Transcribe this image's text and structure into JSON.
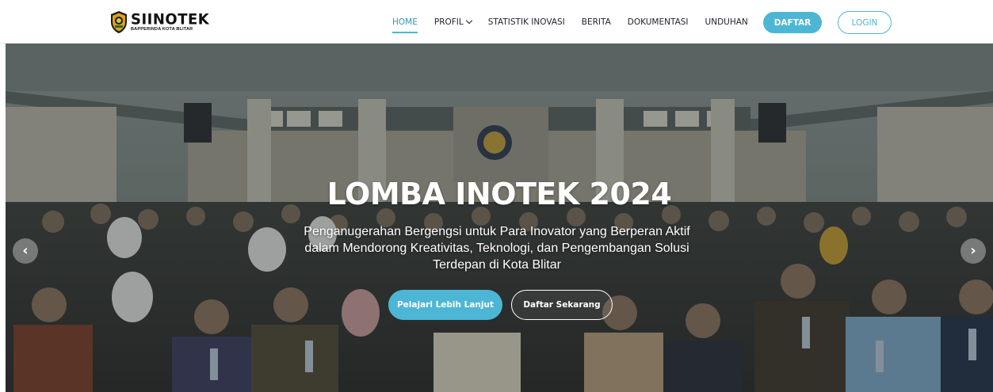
{
  "brand": {
    "name": "SIINOTEK",
    "subtitle": "BAPPERINDA KOTA BLITAR"
  },
  "nav": {
    "items": [
      {
        "label": "HOME",
        "active": true
      },
      {
        "label": "PROFIL",
        "dropdown": true
      },
      {
        "label": "STATISTIK INOVASI"
      },
      {
        "label": "BERITA"
      },
      {
        "label": "DOKUMENTASI"
      },
      {
        "label": "UNDUHAN"
      }
    ],
    "daftar_label": "DAFTAR",
    "login_label": "LOGIN"
  },
  "hero": {
    "title": "LOMBA INOTEK 2024",
    "subtitle": "Penganugerahan Bergengsi untuk Para Inovator yang Berperan Aktif dalam Mendorong Kreativitas, Teknologi, dan Pengembangan Solusi Terdepan di Kota Blitar",
    "primary_button": "Pelajari Lebih Lanjut",
    "secondary_button": "Daftar Sekarang",
    "prev_icon": "chevron-left-icon",
    "next_icon": "chevron-right-icon"
  },
  "colors": {
    "accent": "#4db6d4",
    "active_nav": "#2a97b8"
  }
}
